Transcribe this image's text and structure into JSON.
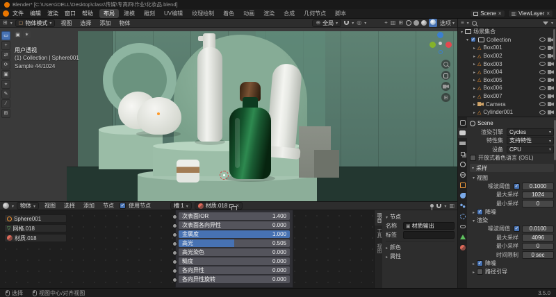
{
  "colors": {
    "accent": "#4772b3",
    "object_orange": "#ef8f2e",
    "axis_x": "#e3484f",
    "axis_y": "#84b32a",
    "axis_z": "#3b7fd0"
  },
  "titlebar": {
    "title": "Blender* [C:\\Users\\DELL\\Desktop\\class\\传媒\\专高四\\作业\\化妆品.blend]"
  },
  "menubar": {
    "menus": [
      "文件",
      "编辑",
      "渲染",
      "窗口",
      "帮助"
    ],
    "workspaces": [
      "布局",
      "建模",
      "雕刻",
      "UV编辑",
      "纹理绘制",
      "着色",
      "动画",
      "渲染",
      "合成",
      "几何节点",
      "脚本"
    ],
    "scene": "Scene",
    "viewlayer": "ViewLayer"
  },
  "viewport": {
    "mode": "物体模式",
    "menus": [
      "视图",
      "选择",
      "添加",
      "物体"
    ],
    "orientation": "全局",
    "options": "选项",
    "overlay": {
      "view": "用户透视",
      "context": "(1) Collection | Sphere001",
      "samples": "Sample 44/1024"
    }
  },
  "outliner": {
    "root": "场景集合",
    "collection": "Collection",
    "objects": [
      "Box001",
      "Box002",
      "Box003",
      "Box004",
      "Box005",
      "Box006",
      "Box007",
      "Camera",
      "Cylinder001"
    ]
  },
  "properties": {
    "breadcrumb": "Scene",
    "engine_label": "渲染引擎",
    "engine": "Cycles",
    "feature_label": "特性集",
    "feature": "支持特性",
    "device_label": "设备",
    "device": "CPU",
    "osl": "开放式着色语言 (OSL)",
    "sampling": "采样",
    "viewport_section": "视图",
    "noise_threshold_label": "噪波阈值",
    "viewport_noise": "0.1000",
    "max_samples_label": "最大采样",
    "viewport_max": "1024",
    "min_samples_label": "最小采样",
    "viewport_min": "0",
    "denoise": "降噪",
    "render_section": "渲染",
    "render_noise": "0.0100",
    "render_max": "4096",
    "render_min": "0",
    "time_limit_label": "时间限制",
    "time_limit": "0 sec",
    "path_guiding": "路径引导"
  },
  "shader": {
    "shader_type": "物体",
    "menus": [
      "视图",
      "选择",
      "添加",
      "节点"
    ],
    "use_nodes": "使用节点",
    "slot": "槽 1",
    "material": "材质.018",
    "breadcrumb": [
      {
        "label": "Sphere001"
      },
      {
        "label": "网格.018"
      },
      {
        "label": "材质.018"
      }
    ],
    "params": [
      {
        "label": "次表面IOR",
        "value": "1.400"
      },
      {
        "label": "次表面各向异性",
        "value": "0.000"
      },
      {
        "label": "金属度",
        "value": "1.000"
      },
      {
        "label": "高光",
        "value": "0.505"
      },
      {
        "label": "高光染色",
        "value": "0.000"
      },
      {
        "label": "糙度",
        "value": "0.000"
      },
      {
        "label": "各向异性",
        "value": "0.000"
      },
      {
        "label": "各向异性旋转",
        "value": "0.000"
      }
    ],
    "npanel": {
      "section": "节点",
      "name_label": "名称",
      "name": "材质输出",
      "label_label": "标签",
      "color": "颜色",
      "props": "属性",
      "tabs": [
        "项目",
        "工具",
        "视图"
      ]
    }
  },
  "statusbar": {
    "hints": [
      "选择",
      "视图中心/对齐视图"
    ],
    "version": "3.5.0"
  }
}
